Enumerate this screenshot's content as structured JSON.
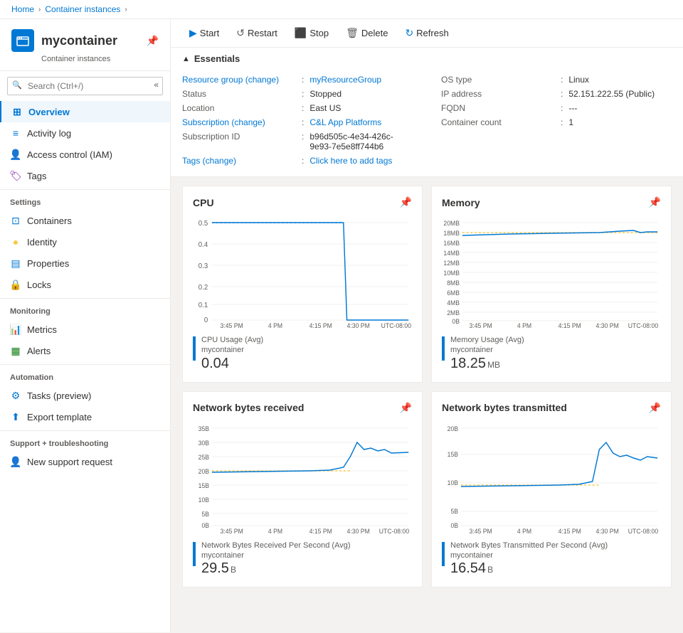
{
  "breadcrumb": {
    "items": [
      "Home",
      "Container instances"
    ],
    "separators": [
      ">",
      ">"
    ]
  },
  "header": {
    "title": "mycontainer",
    "subtitle": "Container instances",
    "icon": "📦"
  },
  "search": {
    "placeholder": "Search (Ctrl+/)"
  },
  "toolbar": {
    "buttons": [
      {
        "label": "Start",
        "icon": "▶",
        "name": "start-button"
      },
      {
        "label": "Restart",
        "icon": "↺",
        "name": "restart-button"
      },
      {
        "label": "Stop",
        "icon": "⬛",
        "name": "stop-button"
      },
      {
        "label": "Delete",
        "icon": "🗑",
        "name": "delete-button"
      },
      {
        "label": "Refresh",
        "icon": "↻",
        "name": "refresh-button"
      }
    ]
  },
  "essentials": {
    "header": "Essentials",
    "left": [
      {
        "label": "Resource group (change)",
        "value": "myResourceGroup",
        "value_link": true
      },
      {
        "label": "Status",
        "value": "Stopped"
      },
      {
        "label": "Location",
        "value": "East US"
      },
      {
        "label": "Subscription (change)",
        "value": "C&L App Platforms",
        "value_link": true
      },
      {
        "label": "Subscription ID",
        "value": "b96d505c-4e34-426c-9e93-7e5e8ff744b6"
      },
      {
        "label": "Tags (change)",
        "value": "Click here to add tags",
        "value_link": true
      }
    ],
    "right": [
      {
        "label": "OS type",
        "value": "Linux"
      },
      {
        "label": "IP address",
        "value": "52.151.222.55 (Public)"
      },
      {
        "label": "FQDN",
        "value": "---"
      },
      {
        "label": "Container count",
        "value": "1"
      }
    ]
  },
  "nav": {
    "overview": "Overview",
    "activity_log": "Activity log",
    "access_control": "Access control (IAM)",
    "tags": "Tags",
    "settings_section": "Settings",
    "containers": "Containers",
    "identity": "Identity",
    "properties": "Properties",
    "locks": "Locks",
    "monitoring_section": "Monitoring",
    "metrics": "Metrics",
    "alerts": "Alerts",
    "automation_section": "Automation",
    "tasks": "Tasks (preview)",
    "export_template": "Export template",
    "support_section": "Support + troubleshooting",
    "new_support": "New support request"
  },
  "charts": {
    "cpu": {
      "title": "CPU",
      "legend_label": "CPU Usage (Avg)",
      "legend_sub": "mycontainer",
      "value": "0.04",
      "unit": "",
      "x_labels": [
        "3:45 PM",
        "4 PM",
        "4:15 PM",
        "4:30 PM",
        "UTC-08:00"
      ],
      "y_labels": [
        "0.5",
        "0.4",
        "0.3",
        "0.2",
        "0.1",
        "0"
      ]
    },
    "memory": {
      "title": "Memory",
      "legend_label": "Memory Usage (Avg)",
      "legend_sub": "mycontainer",
      "value": "18.25",
      "unit": "MB",
      "x_labels": [
        "3:45 PM",
        "4 PM",
        "4:15 PM",
        "4:30 PM",
        "UTC-08:00"
      ],
      "y_labels": [
        "20MB",
        "18MB",
        "16MB",
        "14MB",
        "12MB",
        "10MB",
        "8MB",
        "6MB",
        "4MB",
        "2MB",
        "0B"
      ]
    },
    "network_recv": {
      "title": "Network bytes received",
      "legend_label": "Network Bytes Received Per Second (Avg)",
      "legend_sub": "mycontainer",
      "value": "29.5",
      "unit": "B",
      "x_labels": [
        "3:45 PM",
        "4 PM",
        "4:15 PM",
        "4:30 PM",
        "UTC-08:00"
      ],
      "y_labels": [
        "35B",
        "30B",
        "25B",
        "20B",
        "15B",
        "10B",
        "5B",
        "0B"
      ]
    },
    "network_trans": {
      "title": "Network bytes transmitted",
      "legend_label": "Network Bytes Transmitted Per Second (Avg)",
      "legend_sub": "mycontainer",
      "value": "16.54",
      "unit": "B",
      "x_labels": [
        "3:45 PM",
        "4 PM",
        "4:15 PM",
        "4:30 PM",
        "UTC-08:00"
      ],
      "y_labels": [
        "20B",
        "15B",
        "10B",
        "5B",
        "0B"
      ]
    }
  }
}
